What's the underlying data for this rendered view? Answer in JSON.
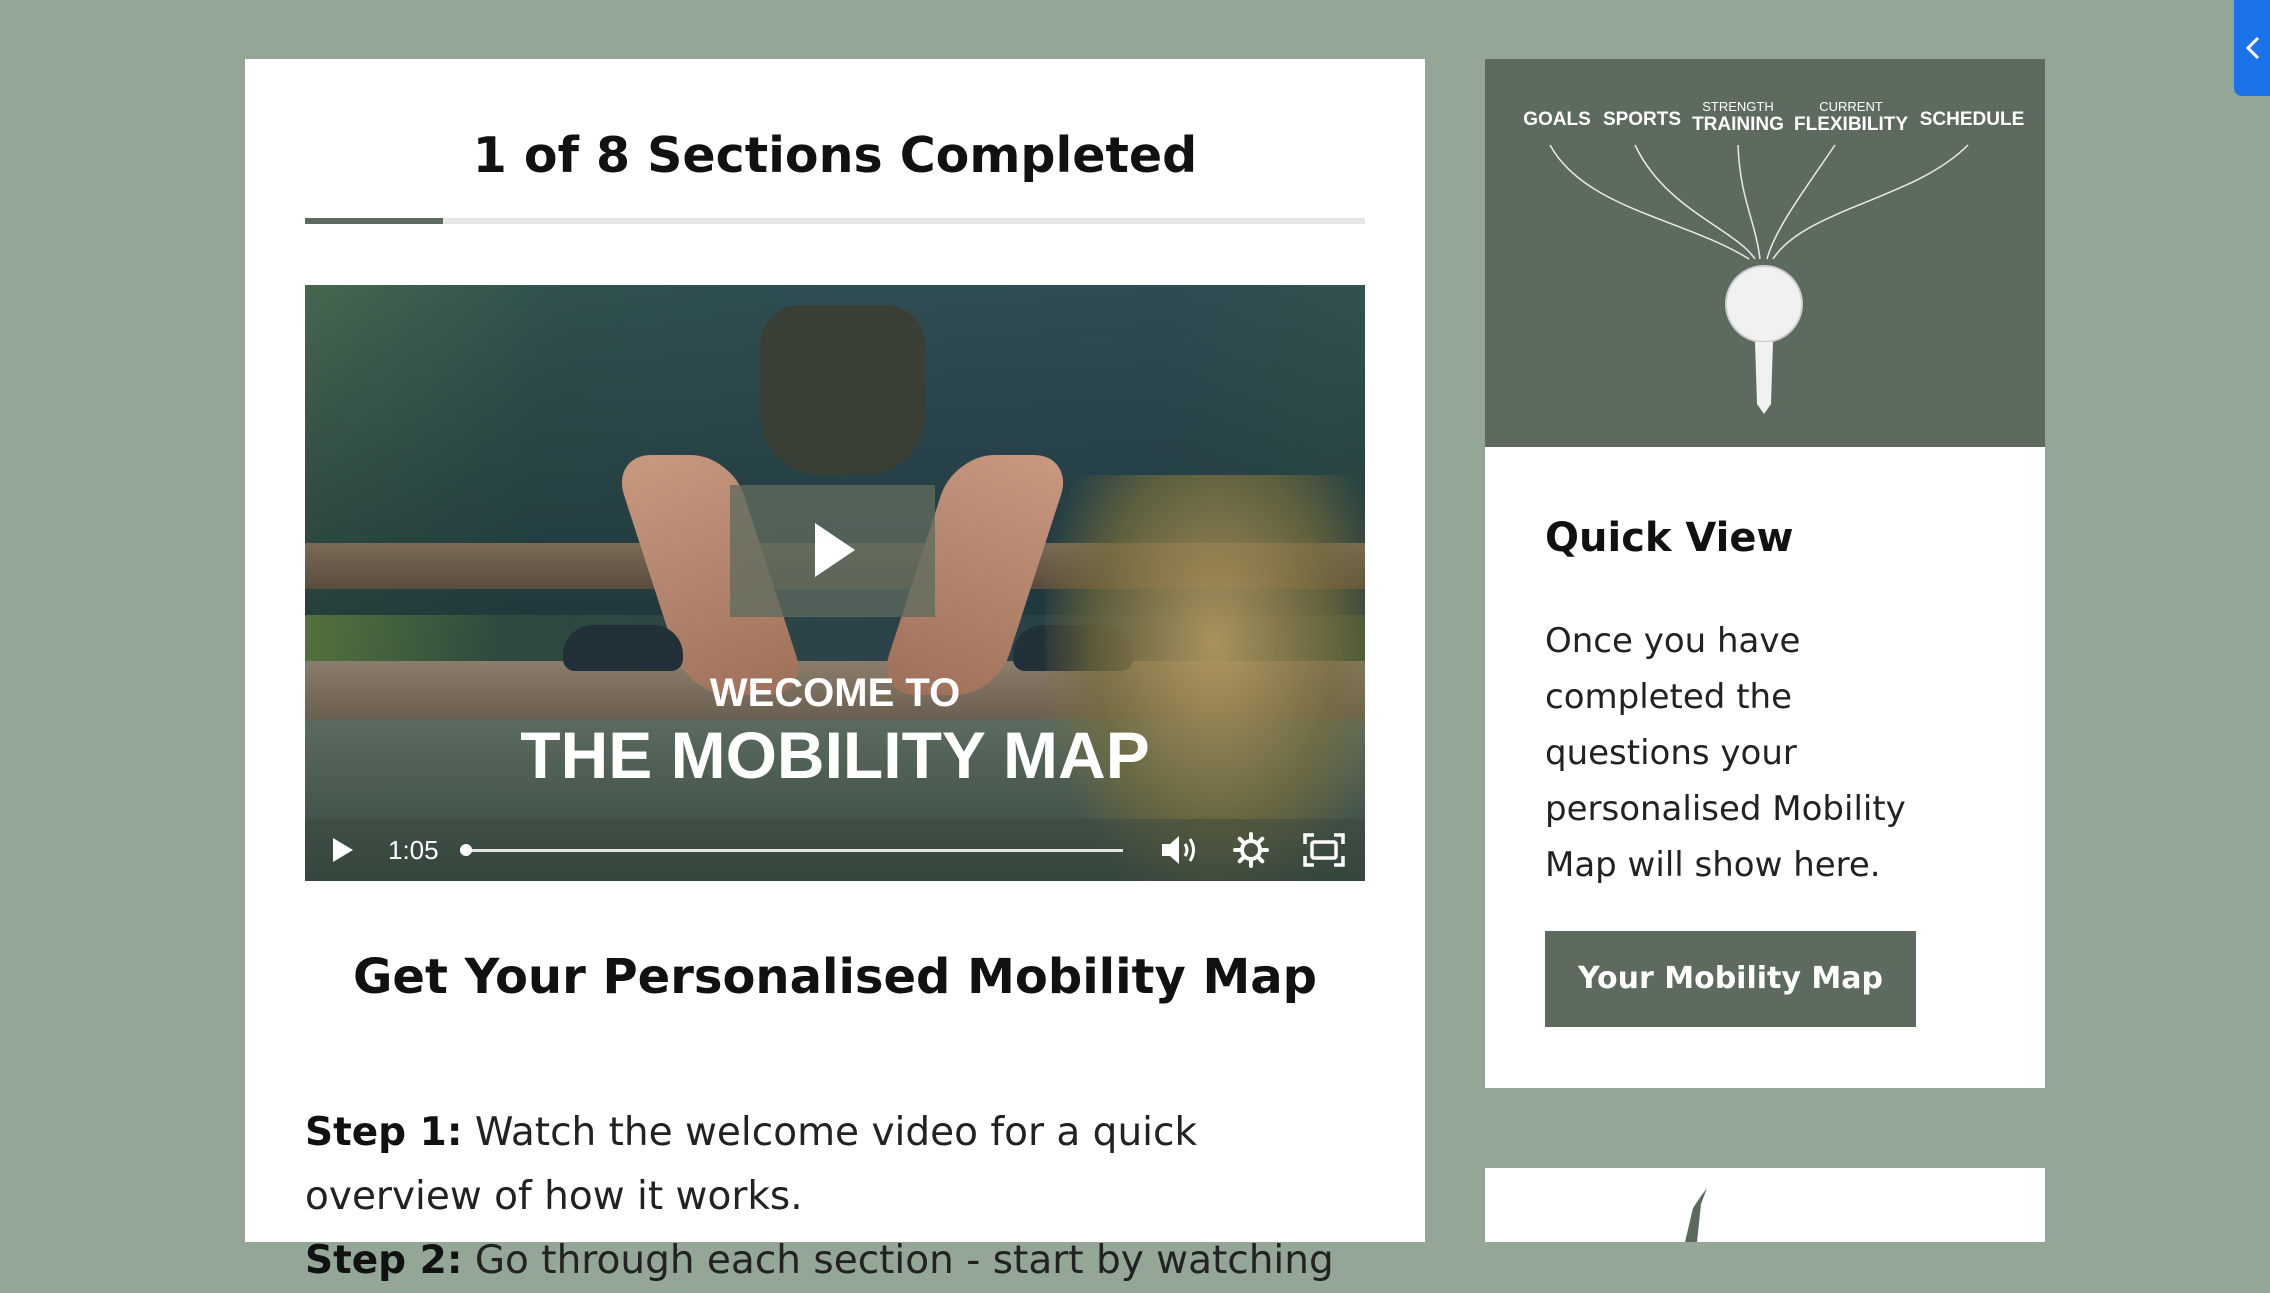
{
  "progress": {
    "title": "1 of 8 Sections Completed",
    "completed": 1,
    "total": 8,
    "fraction": 0.13
  },
  "video": {
    "title_line1": "WECOME TO",
    "title_line2": "THE MOBILITY MAP",
    "time": "1:05",
    "icons": {
      "play": "play-icon",
      "volume": "volume-icon",
      "settings": "gear-icon",
      "fullscreen": "fullscreen-icon"
    }
  },
  "main": {
    "heading": "Get Your Personalised Mobility Map",
    "steps": [
      {
        "label": "Step 1:",
        "text": " Watch the welcome video for a quick overview of how it works."
      },
      {
        "label": "Step 2:",
        "text": " Go through each section - start by watching"
      }
    ]
  },
  "sidebar": {
    "hero_labels": [
      {
        "sup": "",
        "label": "GOALS"
      },
      {
        "sup": "",
        "label": "SPORTS"
      },
      {
        "sup": "STRENGTH",
        "label": "TRAINING"
      },
      {
        "sup": "CURRENT",
        "label": "FLEXIBILITY"
      },
      {
        "sup": "",
        "label": "SCHEDULE"
      }
    ],
    "quick_view": {
      "title": "Quick View",
      "text": "Once you have completed the questions your personalised Mobility Map will show here.",
      "button": "Your Mobility Map"
    }
  },
  "colors": {
    "background": "#94a696",
    "accent": "#5d6b5f",
    "corner_tab": "#1a73e8"
  }
}
